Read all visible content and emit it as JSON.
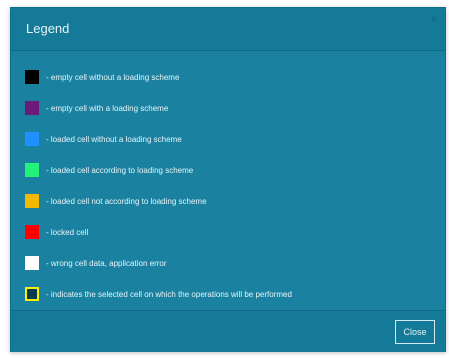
{
  "dialog": {
    "title": "Legend",
    "close_icon_glyph": "×",
    "close_button_label": "Close"
  },
  "legend": {
    "items": [
      {
        "color": "#000000",
        "label": "- empty cell without a loading scheme"
      },
      {
        "color": "#6a1a7a",
        "label": "- empty cell with a loading scheme"
      },
      {
        "color": "#1e90ff",
        "label": "- loaded cell without a loading scheme"
      },
      {
        "color": "#22f27a",
        "label": "- loaded cell according to loading scheme"
      },
      {
        "color": "#f2b800",
        "label": "- loaded cell not according to loading scheme"
      },
      {
        "color": "#ff0000",
        "label": "- locked cell"
      },
      {
        "color": "#ffffff",
        "label": "- wrong cell data, application error"
      },
      {
        "color": "#f7f300",
        "label": "- indicates the selected cell on which the operations will be performed"
      }
    ]
  }
}
